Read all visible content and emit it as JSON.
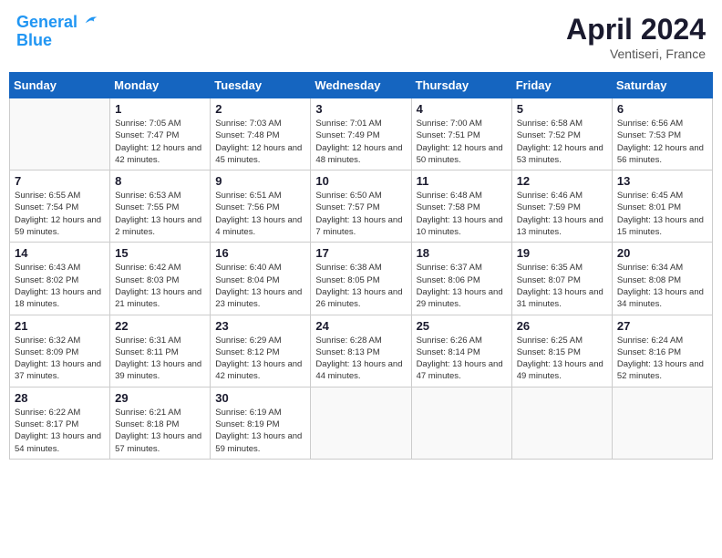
{
  "header": {
    "logo_line1": "General",
    "logo_line2": "Blue",
    "month_year": "April 2024",
    "location": "Ventiseri, France"
  },
  "weekdays": [
    "Sunday",
    "Monday",
    "Tuesday",
    "Wednesday",
    "Thursday",
    "Friday",
    "Saturday"
  ],
  "weeks": [
    [
      {
        "day": "",
        "sunrise": "",
        "sunset": "",
        "daylight": ""
      },
      {
        "day": "1",
        "sunrise": "Sunrise: 7:05 AM",
        "sunset": "Sunset: 7:47 PM",
        "daylight": "Daylight: 12 hours and 42 minutes."
      },
      {
        "day": "2",
        "sunrise": "Sunrise: 7:03 AM",
        "sunset": "Sunset: 7:48 PM",
        "daylight": "Daylight: 12 hours and 45 minutes."
      },
      {
        "day": "3",
        "sunrise": "Sunrise: 7:01 AM",
        "sunset": "Sunset: 7:49 PM",
        "daylight": "Daylight: 12 hours and 48 minutes."
      },
      {
        "day": "4",
        "sunrise": "Sunrise: 7:00 AM",
        "sunset": "Sunset: 7:51 PM",
        "daylight": "Daylight: 12 hours and 50 minutes."
      },
      {
        "day": "5",
        "sunrise": "Sunrise: 6:58 AM",
        "sunset": "Sunset: 7:52 PM",
        "daylight": "Daylight: 12 hours and 53 minutes."
      },
      {
        "day": "6",
        "sunrise": "Sunrise: 6:56 AM",
        "sunset": "Sunset: 7:53 PM",
        "daylight": "Daylight: 12 hours and 56 minutes."
      }
    ],
    [
      {
        "day": "7",
        "sunrise": "Sunrise: 6:55 AM",
        "sunset": "Sunset: 7:54 PM",
        "daylight": "Daylight: 12 hours and 59 minutes."
      },
      {
        "day": "8",
        "sunrise": "Sunrise: 6:53 AM",
        "sunset": "Sunset: 7:55 PM",
        "daylight": "Daylight: 13 hours and 2 minutes."
      },
      {
        "day": "9",
        "sunrise": "Sunrise: 6:51 AM",
        "sunset": "Sunset: 7:56 PM",
        "daylight": "Daylight: 13 hours and 4 minutes."
      },
      {
        "day": "10",
        "sunrise": "Sunrise: 6:50 AM",
        "sunset": "Sunset: 7:57 PM",
        "daylight": "Daylight: 13 hours and 7 minutes."
      },
      {
        "day": "11",
        "sunrise": "Sunrise: 6:48 AM",
        "sunset": "Sunset: 7:58 PM",
        "daylight": "Daylight: 13 hours and 10 minutes."
      },
      {
        "day": "12",
        "sunrise": "Sunrise: 6:46 AM",
        "sunset": "Sunset: 7:59 PM",
        "daylight": "Daylight: 13 hours and 13 minutes."
      },
      {
        "day": "13",
        "sunrise": "Sunrise: 6:45 AM",
        "sunset": "Sunset: 8:01 PM",
        "daylight": "Daylight: 13 hours and 15 minutes."
      }
    ],
    [
      {
        "day": "14",
        "sunrise": "Sunrise: 6:43 AM",
        "sunset": "Sunset: 8:02 PM",
        "daylight": "Daylight: 13 hours and 18 minutes."
      },
      {
        "day": "15",
        "sunrise": "Sunrise: 6:42 AM",
        "sunset": "Sunset: 8:03 PM",
        "daylight": "Daylight: 13 hours and 21 minutes."
      },
      {
        "day": "16",
        "sunrise": "Sunrise: 6:40 AM",
        "sunset": "Sunset: 8:04 PM",
        "daylight": "Daylight: 13 hours and 23 minutes."
      },
      {
        "day": "17",
        "sunrise": "Sunrise: 6:38 AM",
        "sunset": "Sunset: 8:05 PM",
        "daylight": "Daylight: 13 hours and 26 minutes."
      },
      {
        "day": "18",
        "sunrise": "Sunrise: 6:37 AM",
        "sunset": "Sunset: 8:06 PM",
        "daylight": "Daylight: 13 hours and 29 minutes."
      },
      {
        "day": "19",
        "sunrise": "Sunrise: 6:35 AM",
        "sunset": "Sunset: 8:07 PM",
        "daylight": "Daylight: 13 hours and 31 minutes."
      },
      {
        "day": "20",
        "sunrise": "Sunrise: 6:34 AM",
        "sunset": "Sunset: 8:08 PM",
        "daylight": "Daylight: 13 hours and 34 minutes."
      }
    ],
    [
      {
        "day": "21",
        "sunrise": "Sunrise: 6:32 AM",
        "sunset": "Sunset: 8:09 PM",
        "daylight": "Daylight: 13 hours and 37 minutes."
      },
      {
        "day": "22",
        "sunrise": "Sunrise: 6:31 AM",
        "sunset": "Sunset: 8:11 PM",
        "daylight": "Daylight: 13 hours and 39 minutes."
      },
      {
        "day": "23",
        "sunrise": "Sunrise: 6:29 AM",
        "sunset": "Sunset: 8:12 PM",
        "daylight": "Daylight: 13 hours and 42 minutes."
      },
      {
        "day": "24",
        "sunrise": "Sunrise: 6:28 AM",
        "sunset": "Sunset: 8:13 PM",
        "daylight": "Daylight: 13 hours and 44 minutes."
      },
      {
        "day": "25",
        "sunrise": "Sunrise: 6:26 AM",
        "sunset": "Sunset: 8:14 PM",
        "daylight": "Daylight: 13 hours and 47 minutes."
      },
      {
        "day": "26",
        "sunrise": "Sunrise: 6:25 AM",
        "sunset": "Sunset: 8:15 PM",
        "daylight": "Daylight: 13 hours and 49 minutes."
      },
      {
        "day": "27",
        "sunrise": "Sunrise: 6:24 AM",
        "sunset": "Sunset: 8:16 PM",
        "daylight": "Daylight: 13 hours and 52 minutes."
      }
    ],
    [
      {
        "day": "28",
        "sunrise": "Sunrise: 6:22 AM",
        "sunset": "Sunset: 8:17 PM",
        "daylight": "Daylight: 13 hours and 54 minutes."
      },
      {
        "day": "29",
        "sunrise": "Sunrise: 6:21 AM",
        "sunset": "Sunset: 8:18 PM",
        "daylight": "Daylight: 13 hours and 57 minutes."
      },
      {
        "day": "30",
        "sunrise": "Sunrise: 6:19 AM",
        "sunset": "Sunset: 8:19 PM",
        "daylight": "Daylight: 13 hours and 59 minutes."
      },
      {
        "day": "",
        "sunrise": "",
        "sunset": "",
        "daylight": ""
      },
      {
        "day": "",
        "sunrise": "",
        "sunset": "",
        "daylight": ""
      },
      {
        "day": "",
        "sunrise": "",
        "sunset": "",
        "daylight": ""
      },
      {
        "day": "",
        "sunrise": "",
        "sunset": "",
        "daylight": ""
      }
    ]
  ]
}
